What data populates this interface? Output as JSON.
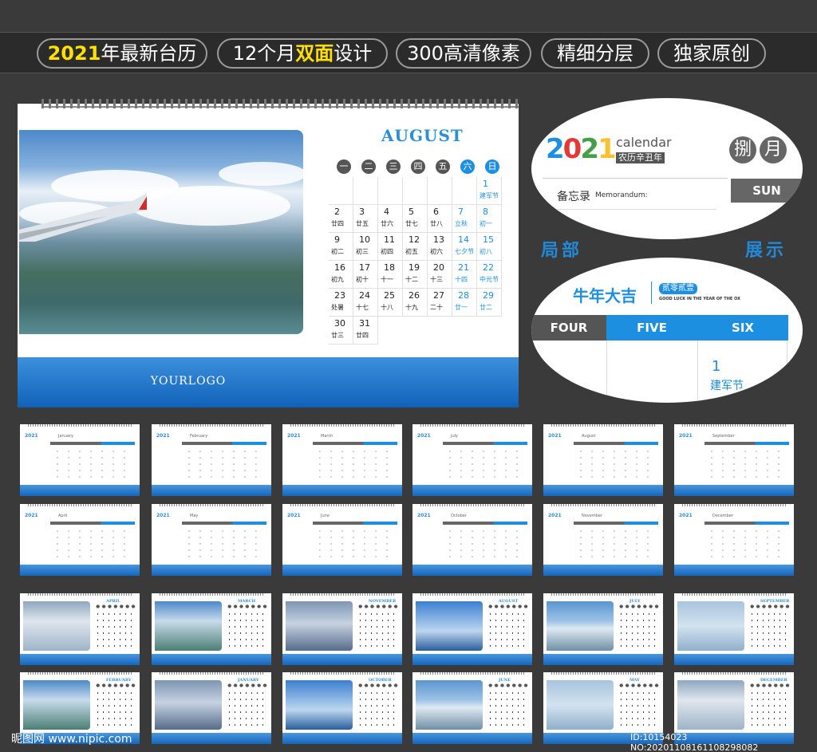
{
  "tags": [
    {
      "pre": "",
      "hl": "2021",
      "post": "年最新台历"
    },
    {
      "pre": "12个月",
      "hl": "双面",
      "post": "设计"
    },
    {
      "pre": "300高清像素",
      "hl": "",
      "post": ""
    },
    {
      "pre": "精细分层",
      "hl": "",
      "post": ""
    },
    {
      "pre": "独家原创",
      "hl": "",
      "post": ""
    }
  ],
  "main": {
    "month": "AUGUST",
    "weekdays": [
      "一",
      "二",
      "三",
      "四",
      "五",
      "六",
      "日"
    ],
    "logo": "YOURLOGO",
    "days": [
      {
        "n": "1",
        "s": "建军节"
      },
      {
        "n": "2",
        "s": "廿四"
      },
      {
        "n": "3",
        "s": "廿五"
      },
      {
        "n": "4",
        "s": "廿六"
      },
      {
        "n": "5",
        "s": "廿七"
      },
      {
        "n": "6",
        "s": "廿八"
      },
      {
        "n": "7",
        "s": "立秋"
      },
      {
        "n": "8",
        "s": "初一"
      },
      {
        "n": "9",
        "s": "初二"
      },
      {
        "n": "10",
        "s": "初三"
      },
      {
        "n": "11",
        "s": "初四"
      },
      {
        "n": "12",
        "s": "初五"
      },
      {
        "n": "13",
        "s": "初六"
      },
      {
        "n": "14",
        "s": "七夕节"
      },
      {
        "n": "15",
        "s": "初八"
      },
      {
        "n": "16",
        "s": "初九"
      },
      {
        "n": "17",
        "s": "初十"
      },
      {
        "n": "18",
        "s": "十一"
      },
      {
        "n": "19",
        "s": "十二"
      },
      {
        "n": "20",
        "s": "十三"
      },
      {
        "n": "21",
        "s": "十四"
      },
      {
        "n": "22",
        "s": "中元节"
      },
      {
        "n": "23",
        "s": "处暑"
      },
      {
        "n": "24",
        "s": "十七"
      },
      {
        "n": "25",
        "s": "十八"
      },
      {
        "n": "26",
        "s": "十九"
      },
      {
        "n": "27",
        "s": "二十"
      },
      {
        "n": "28",
        "s": "廿一"
      },
      {
        "n": "29",
        "s": "廿二"
      },
      {
        "n": "30",
        "s": "廿三"
      },
      {
        "n": "31",
        "s": "廿四"
      }
    ]
  },
  "detail1": {
    "year": "2021",
    "word": "calendar",
    "sub": "农历辛丑年",
    "char1": "捌",
    "char2": "月",
    "memo": "备忘录",
    "memo_en": "Memorandum:",
    "sun": "SUN"
  },
  "labels": {
    "left": "局部",
    "right": "展示"
  },
  "detail2": {
    "title": "牛年大吉",
    "badge": "贰零贰壹",
    "slogan": "GOOD LUCK IN THE YEAR OF THE OX",
    "cols": [
      "FOUR",
      "FIVE",
      "SIX"
    ],
    "day": "1",
    "holiday": "建军节"
  },
  "thumbs_row1": [
    "January",
    "February",
    "March",
    "July",
    "August",
    "September"
  ],
  "thumbs_row2": [
    "April",
    "May",
    "June",
    "October",
    "November",
    "December"
  ],
  "thumbs_row3": [
    "APRIL",
    "MARCH",
    "NOVEMBER",
    "AUGUST",
    "JULY",
    "SEPTEMBER"
  ],
  "thumbs_row4": [
    "FEBRUARY",
    "JANUARY",
    "OCTOBER",
    "JUNE",
    "MAY",
    "DECEMBER"
  ],
  "watermark_left": "昵图网 www.nipic.com",
  "watermark_right": "ID:10154023 NO:20201108161108298082"
}
